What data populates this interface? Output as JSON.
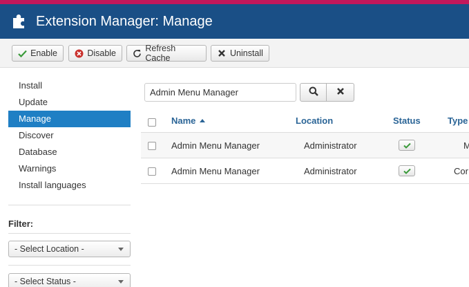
{
  "header": {
    "title": "Extension Manager: Manage",
    "icon": "puzzle-icon",
    "bg_color": "#1a4f86",
    "strip_color": "#c2185b"
  },
  "toolbar": {
    "enable_label": "Enable",
    "disable_label": "Disable",
    "refresh_label": "Refresh Cache",
    "uninstall_label": "Uninstall"
  },
  "sidebar": {
    "items": [
      {
        "label": "Install"
      },
      {
        "label": "Update"
      },
      {
        "label": "Manage",
        "active": true
      },
      {
        "label": "Discover"
      },
      {
        "label": "Database"
      },
      {
        "label": "Warnings"
      },
      {
        "label": "Install languages"
      }
    ],
    "filter_label": "Filter:",
    "location_select": "- Select Location -",
    "status_select": "- Select Status -",
    "active_color": "#1f7fc4"
  },
  "search": {
    "value": "Admin Menu Manager"
  },
  "table": {
    "columns": {
      "name": "Name",
      "location": "Location",
      "status": "Status",
      "type": "Type"
    },
    "rows": [
      {
        "name": "Admin Menu Manager",
        "location": "Administrator",
        "status": "enabled",
        "type": "M"
      },
      {
        "name": "Admin Menu Manager",
        "location": "Administrator",
        "status": "enabled",
        "type": "Cor"
      }
    ]
  }
}
